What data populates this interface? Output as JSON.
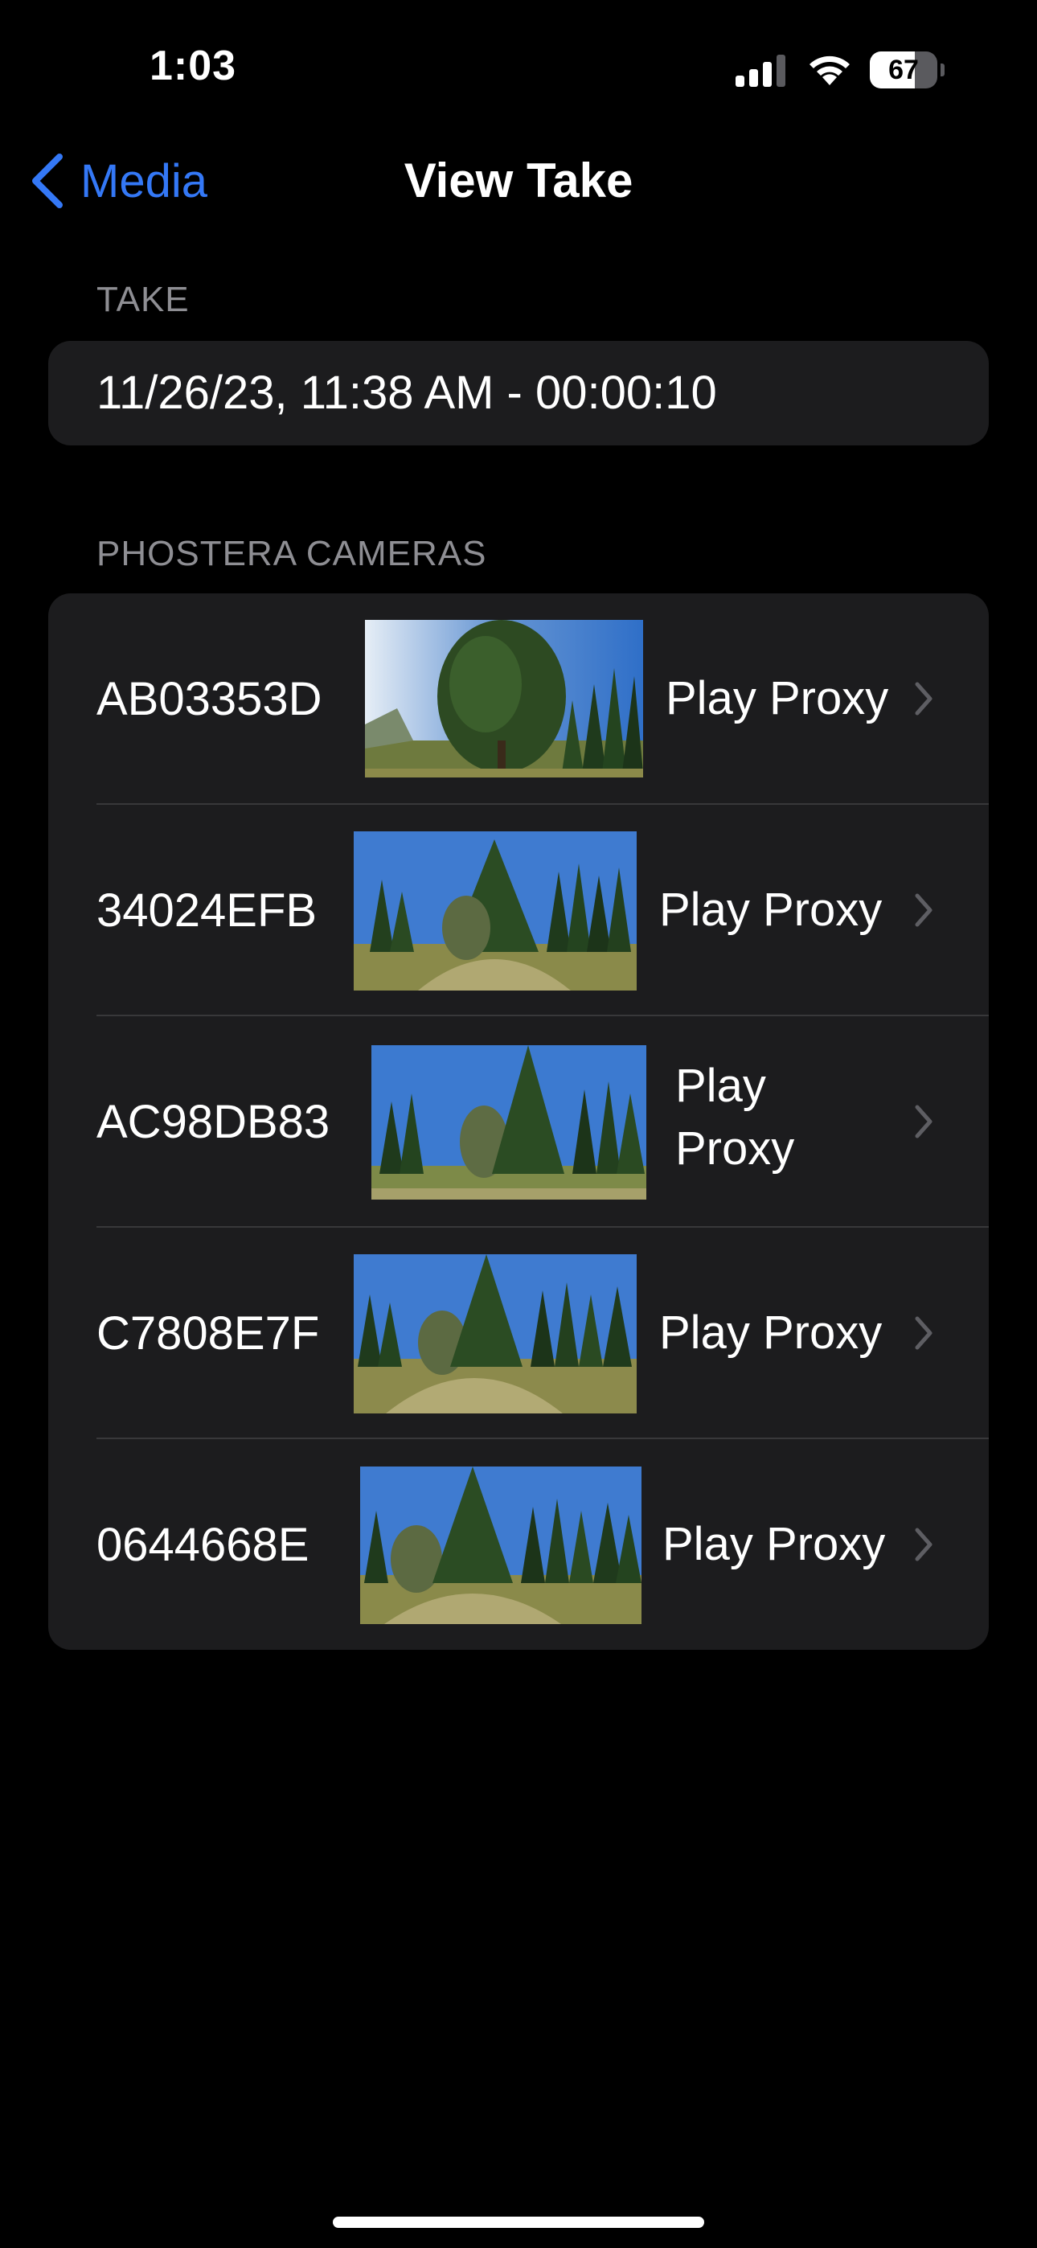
{
  "status_bar": {
    "time": "1:03",
    "battery_percent": "67",
    "battery_level": 0.67
  },
  "nav": {
    "back_label": "Media",
    "title": "View Take"
  },
  "take_section": {
    "header": "TAKE",
    "value": "11/26/23, 11:38 AM - 00:00:10"
  },
  "cameras_section": {
    "header": "PHOSTERA CAMERAS",
    "rows": [
      {
        "id": "AB03353D",
        "action": "Play Proxy"
      },
      {
        "id": "34024EFB",
        "action": "Play Proxy"
      },
      {
        "id": "AC98DB83",
        "action": "Play Proxy"
      },
      {
        "id": "C7808E7F",
        "action": "Play Proxy"
      },
      {
        "id": "0644668E",
        "action": "Play Proxy"
      }
    ]
  },
  "colors": {
    "background": "#000000",
    "card": "#1c1c1e",
    "accent": "#3478f6",
    "secondary_text": "#8e8e93",
    "divider": "#38383a"
  }
}
